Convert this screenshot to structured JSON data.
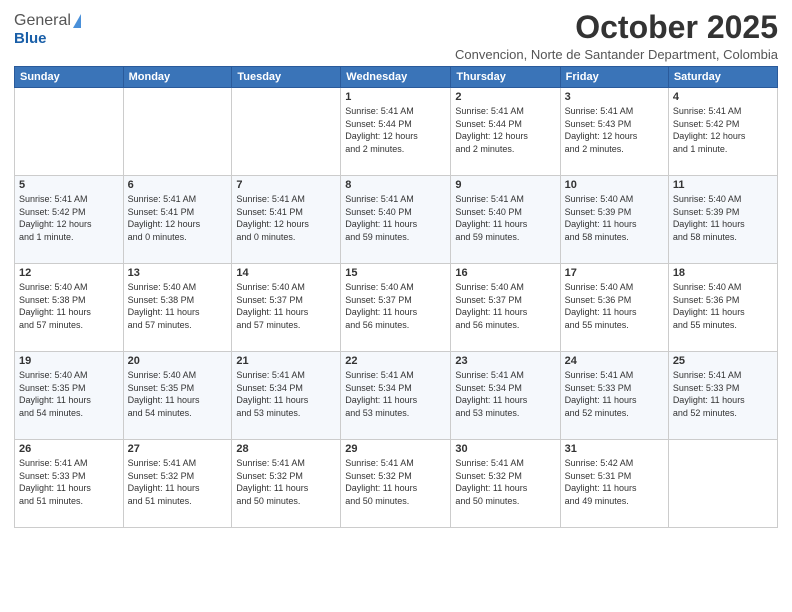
{
  "header": {
    "logo_general": "General",
    "logo_blue": "Blue",
    "month": "October 2025",
    "location": "Convencion, Norte de Santander Department, Colombia"
  },
  "days_of_week": [
    "Sunday",
    "Monday",
    "Tuesday",
    "Wednesday",
    "Thursday",
    "Friday",
    "Saturday"
  ],
  "weeks": [
    [
      {
        "day": "",
        "info": ""
      },
      {
        "day": "",
        "info": ""
      },
      {
        "day": "",
        "info": ""
      },
      {
        "day": "1",
        "info": "Sunrise: 5:41 AM\nSunset: 5:44 PM\nDaylight: 12 hours\nand 2 minutes."
      },
      {
        "day": "2",
        "info": "Sunrise: 5:41 AM\nSunset: 5:44 PM\nDaylight: 12 hours\nand 2 minutes."
      },
      {
        "day": "3",
        "info": "Sunrise: 5:41 AM\nSunset: 5:43 PM\nDaylight: 12 hours\nand 2 minutes."
      },
      {
        "day": "4",
        "info": "Sunrise: 5:41 AM\nSunset: 5:42 PM\nDaylight: 12 hours\nand 1 minute."
      }
    ],
    [
      {
        "day": "5",
        "info": "Sunrise: 5:41 AM\nSunset: 5:42 PM\nDaylight: 12 hours\nand 1 minute."
      },
      {
        "day": "6",
        "info": "Sunrise: 5:41 AM\nSunset: 5:41 PM\nDaylight: 12 hours\nand 0 minutes."
      },
      {
        "day": "7",
        "info": "Sunrise: 5:41 AM\nSunset: 5:41 PM\nDaylight: 12 hours\nand 0 minutes."
      },
      {
        "day": "8",
        "info": "Sunrise: 5:41 AM\nSunset: 5:40 PM\nDaylight: 11 hours\nand 59 minutes."
      },
      {
        "day": "9",
        "info": "Sunrise: 5:41 AM\nSunset: 5:40 PM\nDaylight: 11 hours\nand 59 minutes."
      },
      {
        "day": "10",
        "info": "Sunrise: 5:40 AM\nSunset: 5:39 PM\nDaylight: 11 hours\nand 58 minutes."
      },
      {
        "day": "11",
        "info": "Sunrise: 5:40 AM\nSunset: 5:39 PM\nDaylight: 11 hours\nand 58 minutes."
      }
    ],
    [
      {
        "day": "12",
        "info": "Sunrise: 5:40 AM\nSunset: 5:38 PM\nDaylight: 11 hours\nand 57 minutes."
      },
      {
        "day": "13",
        "info": "Sunrise: 5:40 AM\nSunset: 5:38 PM\nDaylight: 11 hours\nand 57 minutes."
      },
      {
        "day": "14",
        "info": "Sunrise: 5:40 AM\nSunset: 5:37 PM\nDaylight: 11 hours\nand 57 minutes."
      },
      {
        "day": "15",
        "info": "Sunrise: 5:40 AM\nSunset: 5:37 PM\nDaylight: 11 hours\nand 56 minutes."
      },
      {
        "day": "16",
        "info": "Sunrise: 5:40 AM\nSunset: 5:37 PM\nDaylight: 11 hours\nand 56 minutes."
      },
      {
        "day": "17",
        "info": "Sunrise: 5:40 AM\nSunset: 5:36 PM\nDaylight: 11 hours\nand 55 minutes."
      },
      {
        "day": "18",
        "info": "Sunrise: 5:40 AM\nSunset: 5:36 PM\nDaylight: 11 hours\nand 55 minutes."
      }
    ],
    [
      {
        "day": "19",
        "info": "Sunrise: 5:40 AM\nSunset: 5:35 PM\nDaylight: 11 hours\nand 54 minutes."
      },
      {
        "day": "20",
        "info": "Sunrise: 5:40 AM\nSunset: 5:35 PM\nDaylight: 11 hours\nand 54 minutes."
      },
      {
        "day": "21",
        "info": "Sunrise: 5:41 AM\nSunset: 5:34 PM\nDaylight: 11 hours\nand 53 minutes."
      },
      {
        "day": "22",
        "info": "Sunrise: 5:41 AM\nSunset: 5:34 PM\nDaylight: 11 hours\nand 53 minutes."
      },
      {
        "day": "23",
        "info": "Sunrise: 5:41 AM\nSunset: 5:34 PM\nDaylight: 11 hours\nand 53 minutes."
      },
      {
        "day": "24",
        "info": "Sunrise: 5:41 AM\nSunset: 5:33 PM\nDaylight: 11 hours\nand 52 minutes."
      },
      {
        "day": "25",
        "info": "Sunrise: 5:41 AM\nSunset: 5:33 PM\nDaylight: 11 hours\nand 52 minutes."
      }
    ],
    [
      {
        "day": "26",
        "info": "Sunrise: 5:41 AM\nSunset: 5:33 PM\nDaylight: 11 hours\nand 51 minutes."
      },
      {
        "day": "27",
        "info": "Sunrise: 5:41 AM\nSunset: 5:32 PM\nDaylight: 11 hours\nand 51 minutes."
      },
      {
        "day": "28",
        "info": "Sunrise: 5:41 AM\nSunset: 5:32 PM\nDaylight: 11 hours\nand 50 minutes."
      },
      {
        "day": "29",
        "info": "Sunrise: 5:41 AM\nSunset: 5:32 PM\nDaylight: 11 hours\nand 50 minutes."
      },
      {
        "day": "30",
        "info": "Sunrise: 5:41 AM\nSunset: 5:32 PM\nDaylight: 11 hours\nand 50 minutes."
      },
      {
        "day": "31",
        "info": "Sunrise: 5:42 AM\nSunset: 5:31 PM\nDaylight: 11 hours\nand 49 minutes."
      },
      {
        "day": "",
        "info": ""
      }
    ]
  ]
}
